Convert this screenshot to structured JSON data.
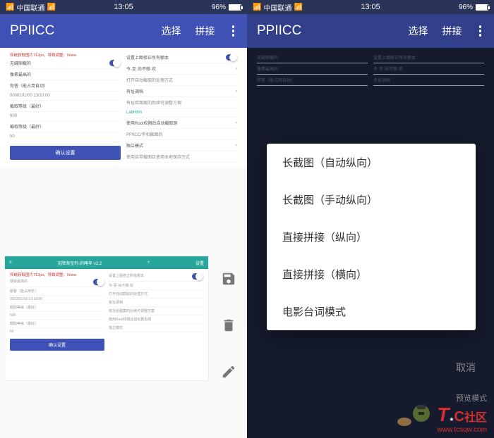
{
  "status": {
    "carrier": "中国联通",
    "time": "13:05",
    "battery_pct": "96%"
  },
  "app": {
    "title": "PPIICC",
    "action_select": "选择",
    "action_concat": "拼接"
  },
  "left_panel": {
    "red_header": "传统获取图片712px，导致调整：None",
    "rows_left": [
      {
        "t": "无缝隙截的"
      },
      {
        "t": "像素最高的"
      },
      {
        "t": "你答（能占用自动）"
      },
      {
        "t": "0000101/00 13/10:00"
      },
      {
        "t": "截取等级（最好）"
      },
      {
        "t": "h00"
      },
      {
        "t": "截取等级（最好）"
      },
      {
        "t": "h0"
      }
    ],
    "rows_right": [
      {
        "t": "设置上图修正所有额本"
      },
      {
        "t": "今·至·尚不够·欢"
      },
      {
        "t": "打开自动截取的处理方式"
      },
      {
        "t": "有址调档"
      },
      {
        "t": "有址给图案的后续可调整方案"
      },
      {
        "t": "LabHtlin"
      },
      {
        "t": "使用Root校限后自动截取原"
      },
      {
        "t": "PPIICC/手机截图的"
      },
      {
        "t": "独立模式"
      },
      {
        "t": "使用自带截图且使用本地保存方式"
      }
    ],
    "confirm_btn": "确认设置"
  },
  "inner": {
    "header_title": "无障淘宝剂-的略年 v2.2",
    "header_add": "+",
    "header_set": "设置",
    "red_line": "传统获取图片712px，导致调整：None",
    "left_rows": [
      "便获最高的",
      "期答（能占用年）",
      "2022/01/18 13:10:00",
      "截取等级（最好）",
      "h00",
      "截取等级（最好）",
      "h0"
    ],
    "right_rows": [
      "设置上图修正所有额本",
      "今·至·尚不够·欢",
      "打开自动截取的处理方式",
      "有址调档",
      "有址给图案的后续可调整方案",
      "使用Root校限后自动截取原",
      "独立模式"
    ],
    "confirm": "确认设置"
  },
  "modal": {
    "items": [
      "长截图（自动纵向）",
      "长截图（手动纵向）",
      "直接拼接（纵向）",
      "直接拼接（横向）",
      "电影台词模式"
    ],
    "cancel": "取消"
  },
  "watermark": {
    "mode": "预览模式",
    "brand_t": "T",
    "brand_c": "C",
    "brand_suffix": "社区",
    "url": "www.tcsqw.com"
  }
}
